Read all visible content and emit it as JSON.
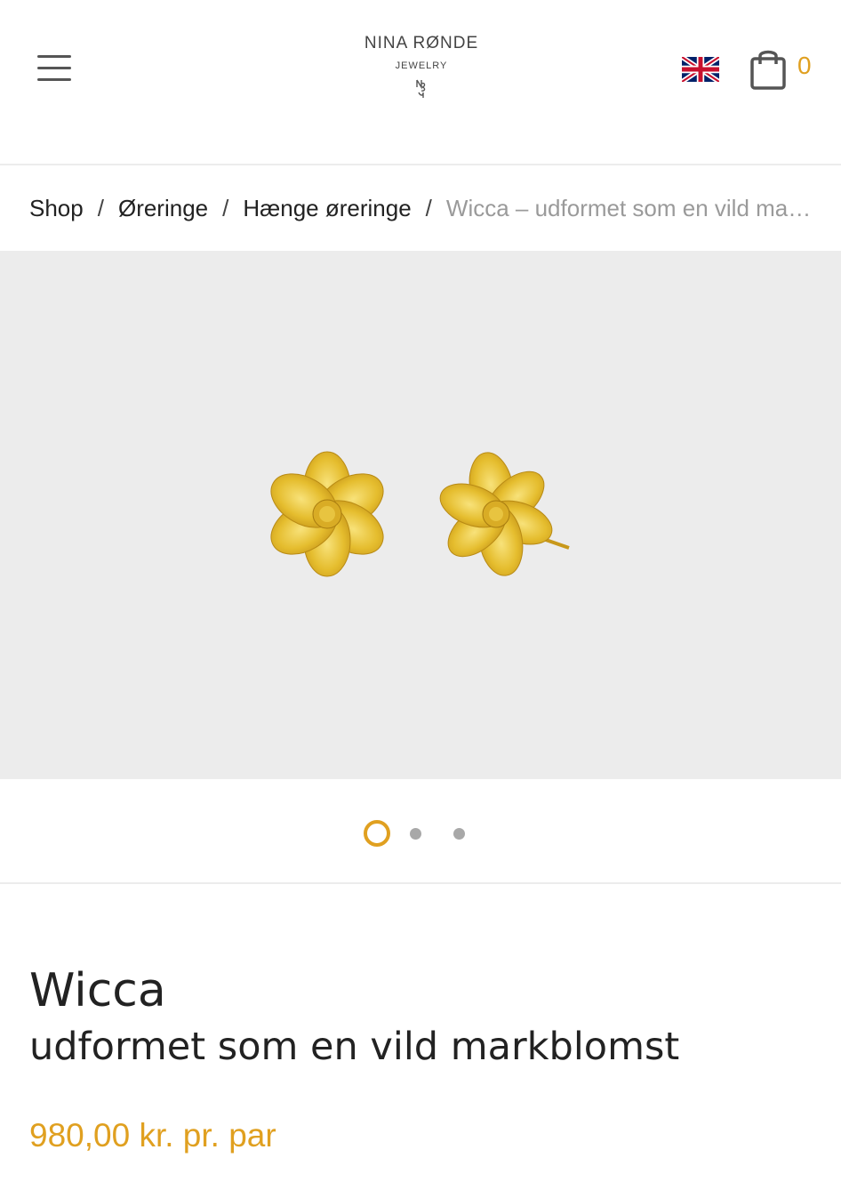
{
  "header": {
    "logo_name": "NINA RØNDE",
    "logo_sub": "JEWELRY",
    "cart_count": "0",
    "language": "English"
  },
  "breadcrumb": {
    "items": [
      "Shop",
      "Øreringe",
      "Hænge øreringe"
    ],
    "separator": "/",
    "current": "Wicca – udformet som en vild markblomst"
  },
  "gallery": {
    "slide_count": 3,
    "active_slide": 1
  },
  "product": {
    "title": "Wicca",
    "subtitle": "udformet som en vild markblomst",
    "price": "980,00 kr. pr. par"
  },
  "colors": {
    "accent": "#e0a020",
    "gallery_bg": "#ececec",
    "text": "#222222",
    "muted": "#9a9a9a"
  }
}
